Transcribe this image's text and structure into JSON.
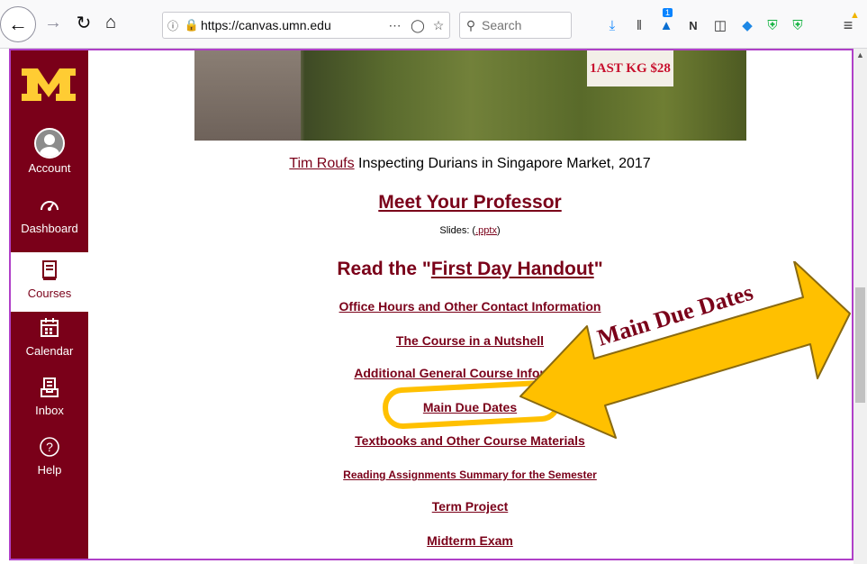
{
  "browser": {
    "url": "https://canvas.umn.edu",
    "search_placeholder": "Search",
    "notification_badge": "1"
  },
  "nav": {
    "logo_text": "M",
    "items": [
      {
        "id": "account",
        "label": "Account",
        "icon": "avatar-icon"
      },
      {
        "id": "dashboard",
        "label": "Dashboard",
        "icon": "speedometer-icon"
      },
      {
        "id": "courses",
        "label": "Courses",
        "icon": "book-icon",
        "active": true
      },
      {
        "id": "calendar",
        "label": "Calendar",
        "icon": "calendar-icon"
      },
      {
        "id": "inbox",
        "label": "Inbox",
        "icon": "inbox-icon"
      },
      {
        "id": "help",
        "label": "Help",
        "icon": "help-icon"
      }
    ]
  },
  "page": {
    "photo_sign": "1AST KG $28",
    "caption_link": "Tim Roufs",
    "caption_rest": " Inspecting Durians in Singapore Market, 2017",
    "meet_title": "Meet Your Professor",
    "slides_label": "Slides: (",
    "slides_link": ".pptx",
    "slides_close": ")",
    "handout_prefix": "Read the \"",
    "handout_link": "First Day Handout",
    "handout_suffix": "\"",
    "links": [
      "Office Hours and Other Contact Information",
      "The Course in a Nutshell",
      "Additional General Course Information",
      "Main Due Dates",
      "Textbooks and Other Course Materials",
      "Reading Assignments Summary for the Semester",
      "Term Project",
      "Midterm Exam"
    ]
  },
  "annotation": {
    "arrow_label": "Main Due Dates"
  },
  "colors": {
    "maroon": "#7a0019",
    "gold": "#ffcc33",
    "highlight": "#ffc000",
    "frame": "#b040c8"
  }
}
